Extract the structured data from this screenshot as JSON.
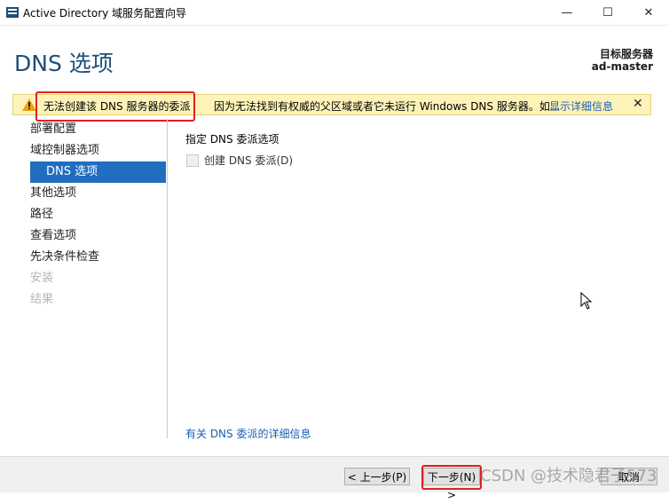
{
  "window": {
    "title": "Active Directory 域服务配置向导",
    "minimize": "—",
    "maximize": "☐",
    "close": "✕"
  },
  "header": {
    "page_title": "DNS 选项",
    "target_label": "目标服务器",
    "target_name": "ad-master"
  },
  "warning": {
    "text_highlight": "无法创建该 DNS 服务器的委派",
    "text_rest": "因为无法找到有权威的父区域或者它未运行 Windows DNS 服务器。如...",
    "link": "显示详细信息",
    "close": "✕",
    "icon": "warning-triangle-icon"
  },
  "nav": {
    "items": [
      {
        "label": "部署配置",
        "state": "normal"
      },
      {
        "label": "域控制器选项",
        "state": "normal"
      },
      {
        "label": "DNS 选项",
        "state": "active"
      },
      {
        "label": "其他选项",
        "state": "normal"
      },
      {
        "label": "路径",
        "state": "normal"
      },
      {
        "label": "查看选项",
        "state": "normal"
      },
      {
        "label": "先决条件检查",
        "state": "normal"
      },
      {
        "label": "安装",
        "state": "disabled"
      },
      {
        "label": "结果",
        "state": "disabled"
      }
    ]
  },
  "content": {
    "section_label": "指定 DNS 委派选项",
    "checkbox_label": "创建 DNS 委派(D)",
    "checkbox_checked": false,
    "more_link": "有关 DNS 委派的详细信息"
  },
  "footer": {
    "prev_label": "< 上一步(P)",
    "next_label": "下一步(N) >",
    "cancel_label": "取消",
    "watermark": "CSDN @技术隐君子573"
  },
  "colors": {
    "title_blue": "#1f4e79",
    "active_blue": "#1f6ec0",
    "warning_bg": "#fdf3b8",
    "highlight_red": "#e02020",
    "link_blue": "#1a5fb4"
  }
}
